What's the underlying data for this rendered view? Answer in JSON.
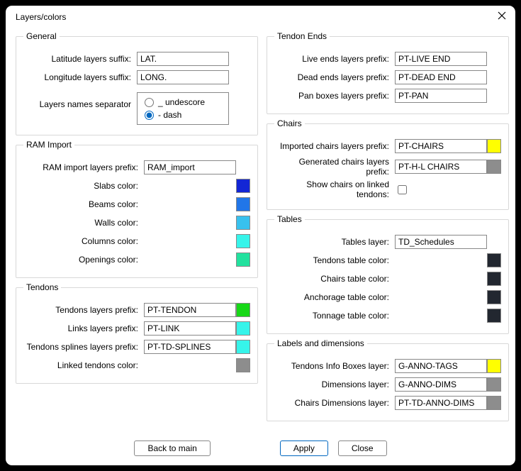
{
  "window": {
    "title": "Layers/colors"
  },
  "buttons": {
    "back": "Back to main",
    "apply": "Apply",
    "close": "Close"
  },
  "general": {
    "legend": "General",
    "latitude_label": "Latitude layers suffix:",
    "latitude_value": "LAT.",
    "longitude_label": "Longitude layers suffix:",
    "longitude_value": "LONG.",
    "separator_label": "Layers names separator",
    "separator_opts": {
      "underscore": "_  undescore",
      "dash": "-  dash",
      "selected": "dash"
    }
  },
  "ram": {
    "legend": "RAM Import",
    "prefix_label": "RAM import layers prefix:",
    "prefix_value": "RAM_import",
    "slabs_label": "Slabs color:",
    "slabs_color": "#1326d5",
    "beams_label": "Beams color:",
    "beams_color": "#2176e8",
    "walls_label": "Walls color:",
    "walls_color": "#38c1ee",
    "columns_label": "Columns color:",
    "columns_color": "#36f4ea",
    "openings_label": "Openings color:",
    "openings_color": "#22e19e"
  },
  "tendons": {
    "legend": "Tendons",
    "prefix_label": "Tendons layers prefix:",
    "prefix_value": "PT-TENDON",
    "prefix_color": "#17d817",
    "links_label": "Links layers prefix:",
    "links_value": "PT-LINK",
    "links_color": "#36f4ea",
    "splines_label": "Tendons splines layers prefix:",
    "splines_value": "PT-TD-SPLINES",
    "splines_color": "#36f4ea",
    "linked_label": "Linked tendons color:",
    "linked_color": "#8d8d8d"
  },
  "tendon_ends": {
    "legend": "Tendon Ends",
    "live_label": "Live ends layers prefix:",
    "live_value": "PT-LIVE END",
    "dead_label": "Dead ends layers prefix:",
    "dead_value": "PT-DEAD END",
    "pan_label": "Pan boxes layers prefix:",
    "pan_value": "PT-PAN"
  },
  "chairs": {
    "legend": "Chairs",
    "imported_label": "Imported chairs layers prefix:",
    "imported_value": "PT-CHAIRS",
    "imported_color": "#ffff00",
    "generated_label": "Generated chairs layers prefix:",
    "generated_value": "PT-H-L CHAIRS",
    "generated_color": "#8d8d8d",
    "show_linked_label": "Show chairs on linked tendons:",
    "show_linked_checked": false
  },
  "tables": {
    "legend": "Tables",
    "layer_label": "Tables layer:",
    "layer_value": "TD_Schedules",
    "tendons_label": "Tendons table color:",
    "tendons_color": "#222730",
    "chairs_label": "Chairs table color:",
    "chairs_color": "#222730",
    "anchorage_label": "Anchorage table color:",
    "anchorage_color": "#222730",
    "tonnage_label": "Tonnage table color:",
    "tonnage_color": "#222730"
  },
  "labels": {
    "legend": "Labels and dimensions",
    "info_label": "Tendons Info Boxes layer:",
    "info_value": "G-ANNO-TAGS",
    "info_color": "#ffff00",
    "dims_label": "Dimensions layer:",
    "dims_value": "G-ANNO-DIMS",
    "dims_color": "#8d8d8d",
    "chair_dims_label": "Chairs Dimensions layer:",
    "chair_dims_value": "PT-TD-ANNO-DIMS",
    "chair_dims_color": "#8d8d8d"
  }
}
